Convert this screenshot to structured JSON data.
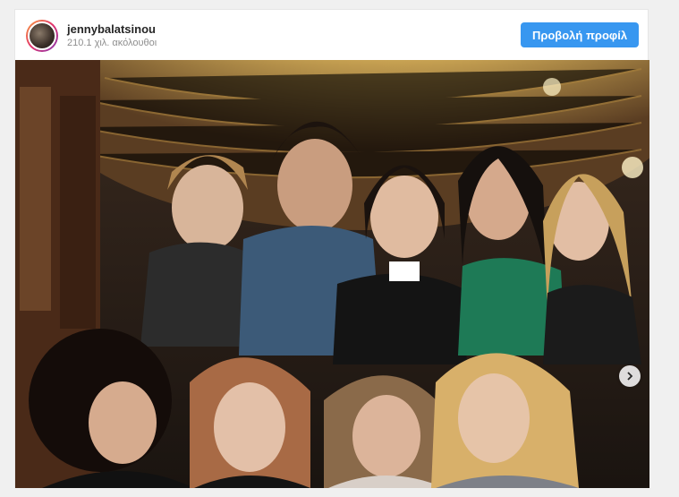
{
  "post": {
    "username": "jennybalatsinou",
    "followers": "210.1 χιλ. ακόλουθοι",
    "view_profile_label": "Προβολή προφίλ"
  },
  "icons": {
    "next": "chevron-right-icon",
    "avatar": "profile-avatar"
  },
  "colors": {
    "accent": "#3897f0"
  }
}
